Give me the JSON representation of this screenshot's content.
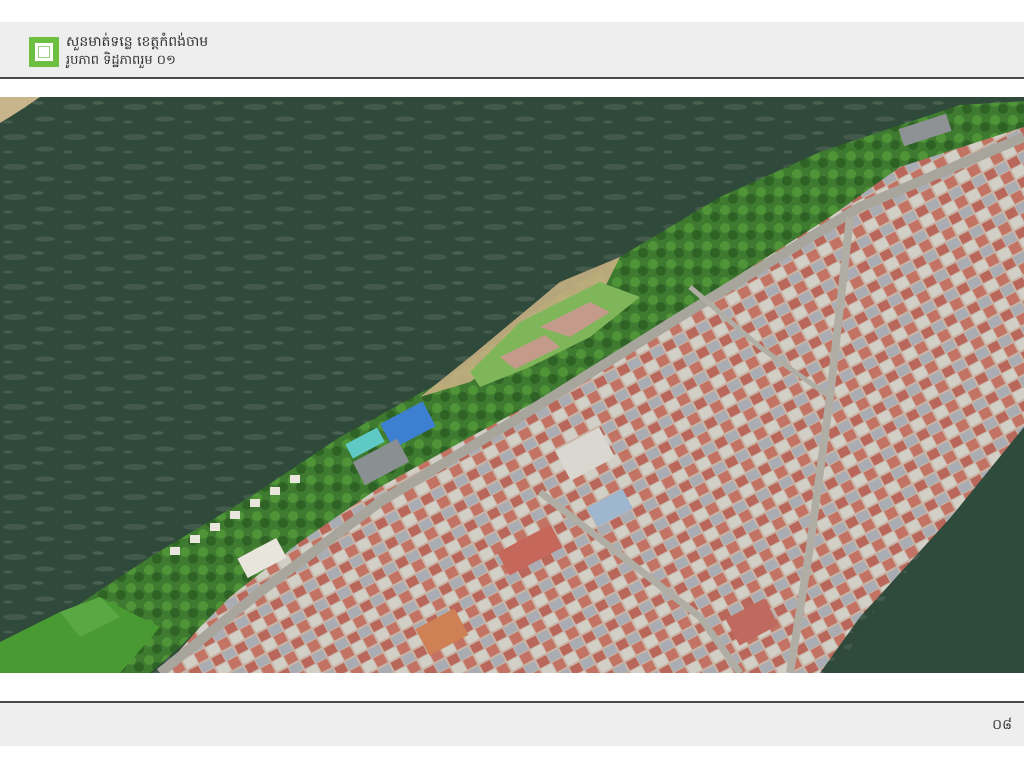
{
  "header": {
    "title": "សួនមាត់ទន្លេ ខេត្តកំពង់ចាម",
    "subtitle": "រូបភាព ទិដ្ឋភាពរួម ០១"
  },
  "render": {
    "icon": "aerial-masterplan-render",
    "colors": {
      "river": "#2f4a3a",
      "park_green": "#3f7d2c",
      "lawn": "#4a9a34",
      "roof_red": "#b86a5c",
      "roof_grey": "#a9adb3",
      "road": "#a8a69c",
      "tennis_court": "#3d7fd0",
      "pool": "#5fc9c5"
    }
  },
  "footer": {
    "page_number": "០៨"
  }
}
